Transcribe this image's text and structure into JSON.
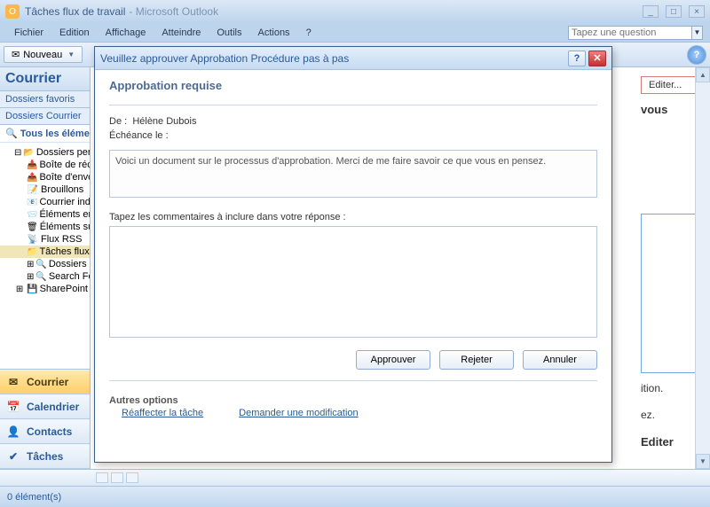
{
  "titlebar": {
    "main": "Tâches flux de travail",
    "sub": "- Microsoft Outlook"
  },
  "menubar": {
    "items": [
      "Fichier",
      "Edition",
      "Affichage",
      "Atteindre",
      "Outils",
      "Actions",
      "?"
    ],
    "question_placeholder": "Tapez une question"
  },
  "toolbar": {
    "new_label": "Nouveau"
  },
  "sidebar": {
    "header": "Courrier",
    "fav": "Dossiers favoris",
    "mail": "Dossiers Courrier",
    "all": "Tous les éléments",
    "tree": [
      {
        "label": "Dossiers personnels",
        "indent": 1,
        "ic": "📂",
        "exp": "⊟"
      },
      {
        "label": "Boîte de réception",
        "indent": 2,
        "ic": "📥"
      },
      {
        "label": "Boîte d'envoi",
        "indent": 2,
        "ic": "📤"
      },
      {
        "label": "Brouillons",
        "indent": 2,
        "ic": "📝"
      },
      {
        "label": "Courrier indésirable",
        "indent": 2,
        "ic": "📧"
      },
      {
        "label": "Éléments envoyés",
        "indent": 2,
        "ic": "📨"
      },
      {
        "label": "Éléments supprimés",
        "indent": 2,
        "ic": "🗑"
      },
      {
        "label": "Flux RSS",
        "indent": 2,
        "ic": "📡"
      },
      {
        "label": "Tâches flux de travail",
        "indent": 2,
        "ic": "📁",
        "selected": true
      },
      {
        "label": "Dossiers de recherche",
        "indent": 2,
        "ic": "🔍",
        "exp": "⊞"
      },
      {
        "label": "Search Folders",
        "indent": 2,
        "ic": "🔍",
        "exp": "⊞"
      },
      {
        "label": "SharePoint",
        "indent": 1,
        "ic": "💾",
        "exp": "⊞"
      }
    ],
    "nav": [
      {
        "label": "Courrier",
        "ic": "✉",
        "active": true
      },
      {
        "label": "Calendrier",
        "ic": "📅"
      },
      {
        "label": "Contacts",
        "ic": "👤"
      },
      {
        "label": "Tâches",
        "ic": "✔"
      }
    ]
  },
  "preview": {
    "edit": "Editer...",
    "vous": "vous",
    "line1": "ition.",
    "line2": "ez.",
    "editer": "Editer"
  },
  "modal": {
    "title": "Veuillez approuver Approbation Procédure pas à pas",
    "heading": "Approbation requise",
    "from_label": "De :",
    "from_value": "Hélène Dubois",
    "due_label": "Échéance le :",
    "message": "Voici un document sur le processus d'approbation. Merci de me faire savoir ce que vous en pensez.",
    "comments_label": "Tapez les commentaires à inclure dans votre réponse :",
    "approve": "Approuver",
    "reject": "Rejeter",
    "cancel": "Annuler",
    "other_heading": "Autres options",
    "link_reassign": "Réaffecter la tâche",
    "link_change": "Demander une modification"
  },
  "statusbar": {
    "items": "0 élément(s)"
  }
}
